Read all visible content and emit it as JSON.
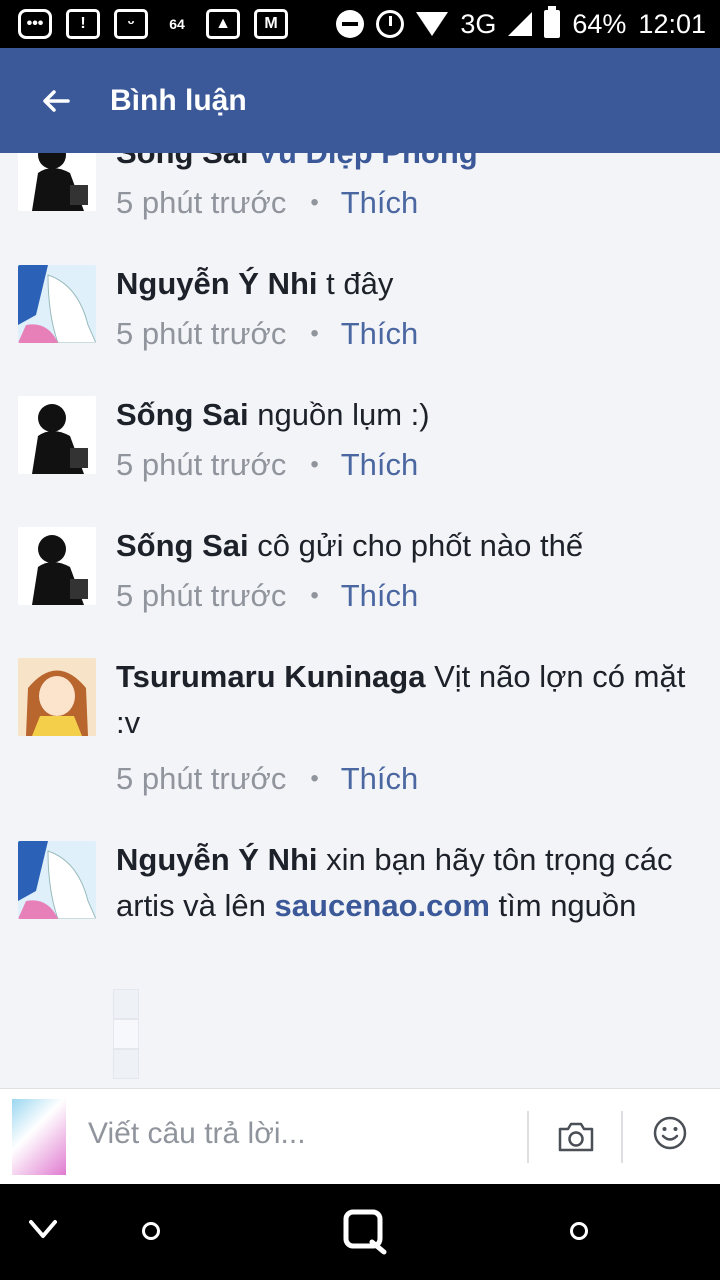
{
  "status_bar": {
    "notif_badge": "64",
    "three_g": "3G",
    "battery_percent": "64%",
    "time": "12:01"
  },
  "appbar": {
    "title": "Bình luận"
  },
  "comments": [
    {
      "author": "Sống Sai",
      "mention": "Vũ Diệp Phong",
      "text": "",
      "time": "5 phút trước",
      "like_label": "Thích"
    },
    {
      "author": "Nguyễn Ý Nhi",
      "text": "t đây",
      "time": "5 phút trước",
      "like_label": "Thích"
    },
    {
      "author": "Sống Sai",
      "text": "nguồn lụm :)",
      "time": "5 phút trước",
      "like_label": "Thích"
    },
    {
      "author": "Sống Sai",
      "text": "cô gửi cho phốt nào thế",
      "time": "5 phút trước",
      "like_label": "Thích"
    },
    {
      "author": "Tsurumaru Kuninaga",
      "text": "Vịt não lợn có mặt :v",
      "time": "5 phút trước",
      "like_label": "Thích"
    },
    {
      "author": "Nguyễn Ý Nhi",
      "text_before": "xin bạn hãy tôn trọng các artis và lên",
      "link": "saucenao.com",
      "text_after": "tìm nguồn"
    }
  ],
  "composer": {
    "placeholder": "Viết câu trả lời..."
  },
  "icons": {
    "back": "arrow-left-icon",
    "camera": "camera-icon",
    "emoji": "smiley-icon"
  },
  "colors": {
    "brand": "#3b5998",
    "background": "#f3f4f7",
    "like": "#4b67a1",
    "meta": "#90949c"
  }
}
